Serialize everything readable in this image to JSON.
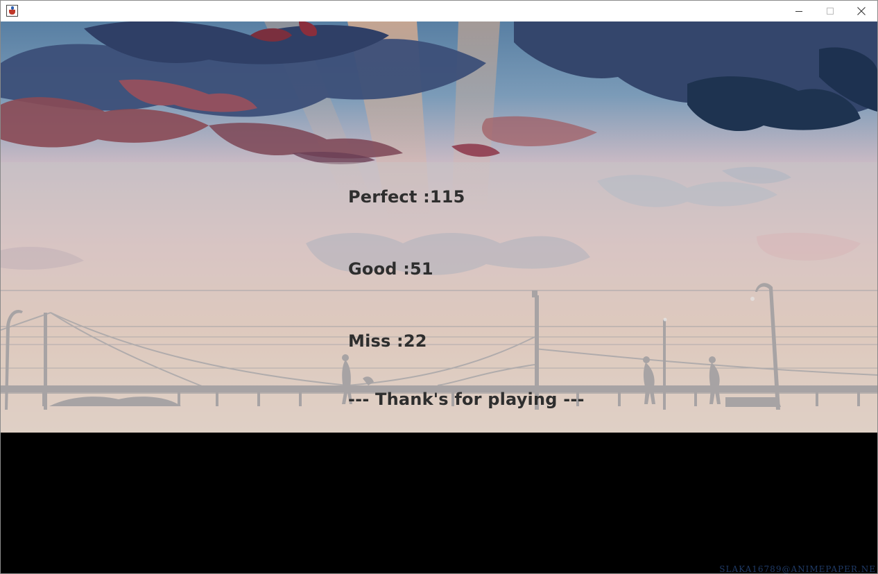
{
  "window": {
    "title": "",
    "icon": "java-cup-icon",
    "controls": {
      "minimize": "minimize-icon",
      "maximize": "maximize-icon",
      "close": "close-icon"
    }
  },
  "results": {
    "perfect": "Perfect :115",
    "good": "Good :51",
    "miss": "Miss :22",
    "thanks": "--- Thank's for playing ---"
  },
  "watermark": "SLAKA16789@ANIMEPAPER.NE",
  "colors": {
    "text": "#2e2e2e",
    "overlay": "rgba(200,200,200,0.45)",
    "sky_top": "#5f86a8",
    "sky_bottom": "#e9c0b4"
  }
}
